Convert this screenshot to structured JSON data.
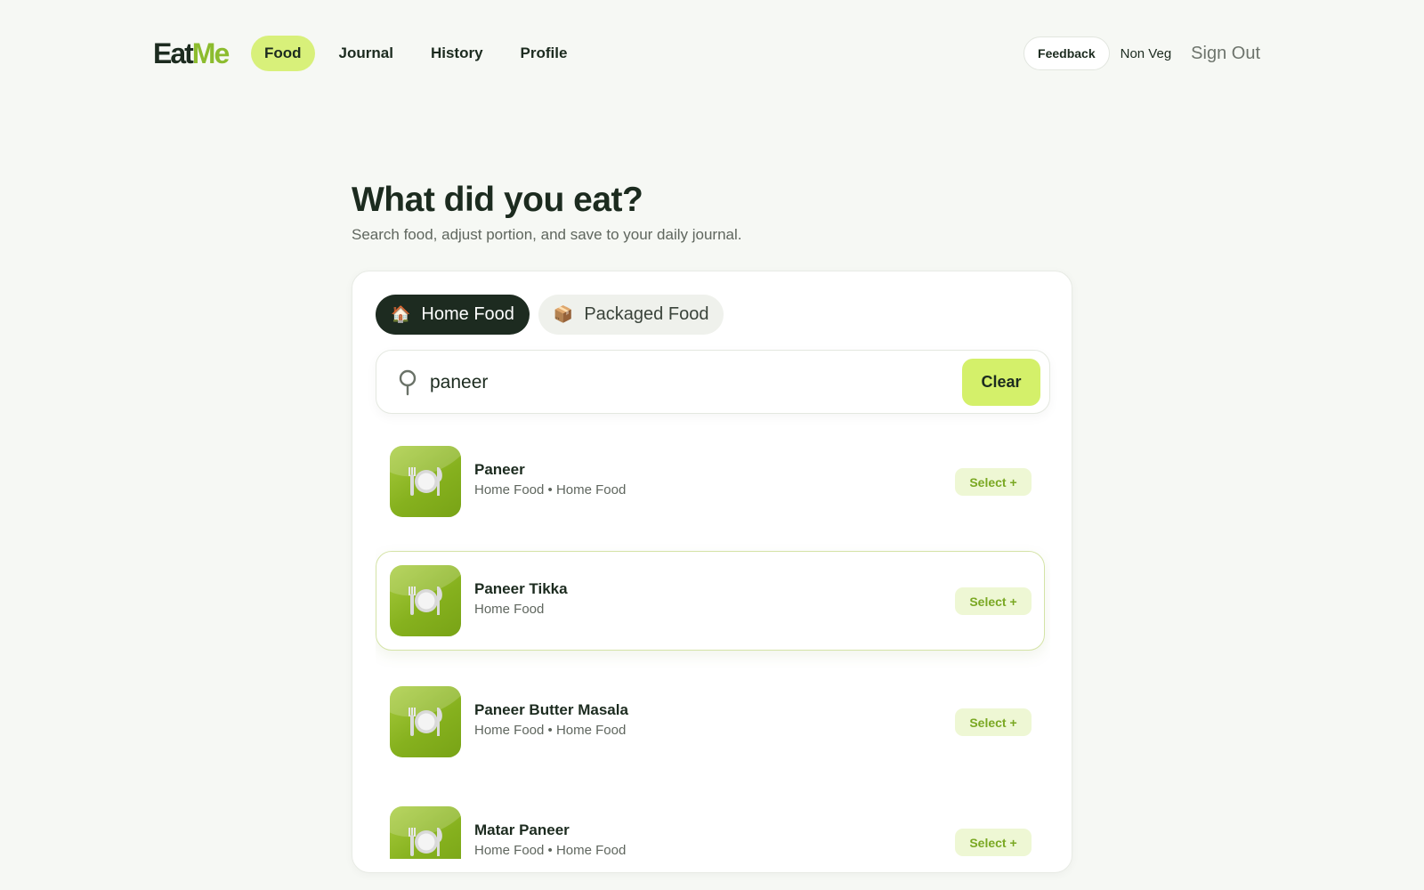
{
  "brand": {
    "part1": "Eat",
    "part2": "Me"
  },
  "nav": {
    "items": [
      {
        "label": "Food",
        "active": true
      },
      {
        "label": "Journal",
        "active": false
      },
      {
        "label": "History",
        "active": false
      },
      {
        "label": "Profile",
        "active": false
      }
    ]
  },
  "header_right": {
    "feedback_label": "Feedback",
    "diet_preference": "Non Veg",
    "signout_label": "Sign Out"
  },
  "page": {
    "title": "What did you eat?",
    "subtitle": "Search food, adjust portion, and save to your daily journal."
  },
  "tabs": [
    {
      "label": "Home Food",
      "icon": "house-icon",
      "glyph": "🏠",
      "active": true
    },
    {
      "label": "Packaged Food",
      "icon": "package-icon",
      "glyph": "📦",
      "active": false
    }
  ],
  "search": {
    "value": "paneer",
    "clear_label": "Clear"
  },
  "results": [
    {
      "name": "Paneer",
      "meta": "Home Food • Home Food",
      "select_label": "Select +",
      "highlighted": false
    },
    {
      "name": "Paneer Tikka",
      "meta": "Home Food",
      "select_label": "Select +",
      "highlighted": true
    },
    {
      "name": "Paneer Butter Masala",
      "meta": "Home Food • Home Food",
      "select_label": "Select +",
      "highlighted": false
    },
    {
      "name": "Matar Paneer",
      "meta": "Home Food • Home Food",
      "select_label": "Select +",
      "highlighted": false
    }
  ],
  "colors": {
    "accent": "#d8f07a",
    "brand_green": "#8cbc2e",
    "dark": "#1d2b20"
  }
}
